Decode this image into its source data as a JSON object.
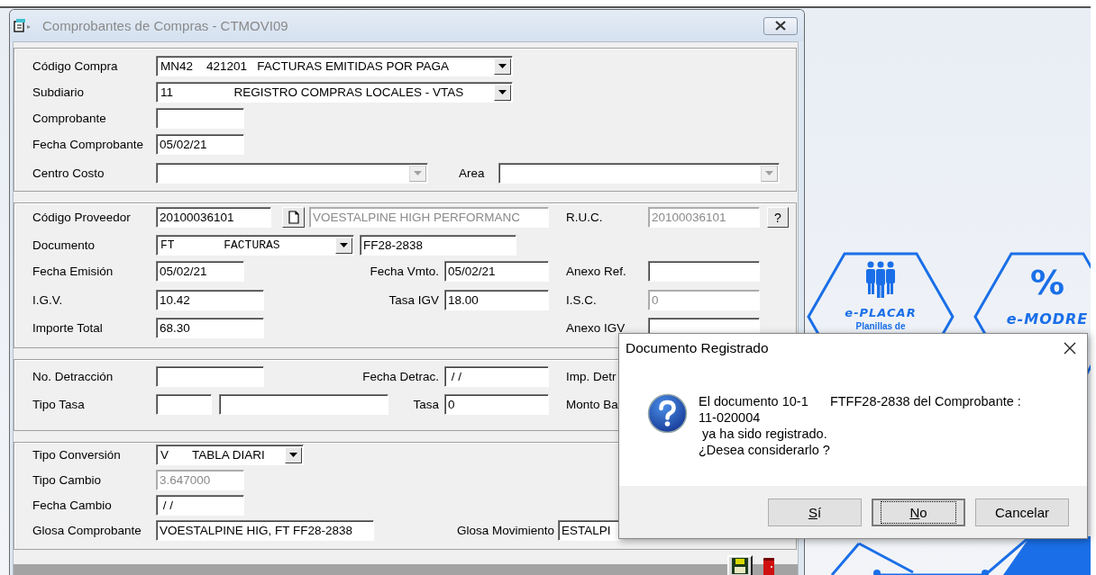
{
  "desktop": {
    "tiles": [
      {
        "kind": "people",
        "title": "e-PLACAR",
        "subtitle": "Planillas de"
      },
      {
        "kind": "percent",
        "symbol": "%",
        "title": "e-MODRE"
      }
    ]
  },
  "main_window": {
    "title": "Comprobantes de Compras - CTMOVI09",
    "sections": [
      {
        "rows": [
          {
            "items": [
              {
                "kind": "label",
                "text": "Código Compra"
              },
              {
                "kind": "combo",
                "value": "MN42    421201   FACTURAS EMITIDAS POR PAGA",
                "disabled": false
              }
            ]
          },
          {
            "items": [
              {
                "kind": "label",
                "text": "Subdiario"
              },
              {
                "kind": "combo",
                "value": "11                  REGISTRO COMPRAS LOCALES - VTAS",
                "disabled": false
              }
            ]
          },
          {
            "items": [
              {
                "kind": "label",
                "text": "Comprobante"
              },
              {
                "kind": "field",
                "value": "",
                "disabled": false
              }
            ]
          },
          {
            "items": [
              {
                "kind": "label",
                "text": "Fecha Comprobante"
              },
              {
                "kind": "field",
                "value": "05/02/21",
                "disabled": false
              }
            ]
          },
          {
            "items": [
              {
                "kind": "label",
                "text": "Centro Costo"
              },
              {
                "kind": "combo",
                "value": "",
                "disabled": true
              },
              {
                "kind": "label",
                "text": "Area"
              },
              {
                "kind": "combo",
                "value": "",
                "disabled": true
              }
            ]
          }
        ]
      },
      {
        "rows": [
          {
            "items": [
              {
                "kind": "label",
                "text": "Código Proveedor"
              },
              {
                "kind": "field",
                "value": "20100036101",
                "disabled": false
              },
              {
                "kind": "page_button"
              },
              {
                "kind": "field",
                "value": "VOESTALPINE HIGH PERFORMANC",
                "disabled": true
              },
              {
                "kind": "label",
                "text": "R.U.C."
              },
              {
                "kind": "field",
                "value": "20100036101",
                "disabled": true
              },
              {
                "kind": "text_button",
                "text": "?"
              }
            ]
          },
          {
            "items": [
              {
                "kind": "label",
                "text": "Documento"
              },
              {
                "kind": "mono_combo",
                "value": "FT       FACTURAS",
                "disabled": false
              },
              {
                "kind": "field",
                "value": "FF28-2838",
                "disabled": false
              }
            ]
          },
          {
            "items": [
              {
                "kind": "label",
                "text": "Fecha Emisión"
              },
              {
                "kind": "field",
                "value": "05/02/21",
                "disabled": false
              },
              {
                "kind": "label",
                "text": "Fecha Vmto."
              },
              {
                "kind": "field",
                "value": "05/02/21",
                "disabled": false
              },
              {
                "kind": "label",
                "text": "Anexo Ref."
              },
              {
                "kind": "field",
                "value": "",
                "disabled": false
              }
            ]
          },
          {
            "items": [
              {
                "kind": "label",
                "text": "I.G.V."
              },
              {
                "kind": "field",
                "value": "10.42",
                "disabled": false
              },
              {
                "kind": "label",
                "text": "Tasa IGV"
              },
              {
                "kind": "field",
                "value": "18.00",
                "disabled": false
              },
              {
                "kind": "label",
                "text": "I.S.C."
              },
              {
                "kind": "field",
                "value": "0",
                "disabled": true
              }
            ]
          },
          {
            "items": [
              {
                "kind": "label",
                "text": "Importe Total"
              },
              {
                "kind": "field",
                "value": "68.30",
                "disabled": false
              },
              {
                "kind": "label",
                "text": "Anexo IGV"
              },
              {
                "kind": "field",
                "value": "",
                "disabled": false
              }
            ]
          }
        ]
      },
      {
        "rows": [
          {
            "items": [
              {
                "kind": "label",
                "text": "No. Detracción"
              },
              {
                "kind": "field",
                "value": "",
                "disabled": false
              },
              {
                "kind": "label",
                "text": "Fecha Detrac."
              },
              {
                "kind": "field",
                "value": " / /",
                "disabled": false
              },
              {
                "kind": "label",
                "text": "Imp. Detr"
              }
            ]
          },
          {
            "items": [
              {
                "kind": "label",
                "text": "Tipo Tasa"
              },
              {
                "kind": "field",
                "value": "",
                "disabled": false
              },
              {
                "kind": "field",
                "value": "",
                "disabled": false
              },
              {
                "kind": "label",
                "text": "Tasa"
              },
              {
                "kind": "field",
                "value": "0",
                "disabled": false
              },
              {
                "kind": "label",
                "text": "Monto Ba"
              }
            ]
          }
        ]
      },
      {
        "rows": [
          {
            "items": [
              {
                "kind": "label",
                "text": "Tipo Conversión"
              },
              {
                "kind": "combo",
                "value": "V       TABLA DIARI",
                "disabled": false
              }
            ]
          },
          {
            "items": [
              {
                "kind": "label",
                "text": "Tipo Cambio"
              },
              {
                "kind": "field",
                "value": "3.647000",
                "disabled": true
              }
            ]
          },
          {
            "items": [
              {
                "kind": "label",
                "text": "Fecha Cambio"
              },
              {
                "kind": "field",
                "value": " / /",
                "disabled": false
              }
            ]
          },
          {
            "items": [
              {
                "kind": "label",
                "text": "Glosa Comprobante"
              },
              {
                "kind": "field",
                "value": "VOESTALPINE HIG, FT FF28-2838",
                "disabled": false
              },
              {
                "kind": "label",
                "text": "Glosa Movimiento"
              },
              {
                "kind": "field",
                "value": "ESTALPI",
                "disabled": false
              }
            ]
          }
        ]
      }
    ],
    "toolbar": [
      {
        "kind": "save"
      },
      {
        "kind": "exit"
      }
    ]
  },
  "dialog": {
    "title": "Documento Registrado",
    "message": "El documento 10-1      FTFF28-2838 del Comprobante :\n11-020004\n ya ha sido registrado.\n¿Desea considerarlo ?",
    "buttons": [
      {
        "label": "Sí",
        "underline_first": true,
        "focused": false
      },
      {
        "label": "No",
        "underline_first": true,
        "focused": true
      },
      {
        "label": "Cancelar",
        "underline_first": false,
        "focused": false
      }
    ]
  }
}
